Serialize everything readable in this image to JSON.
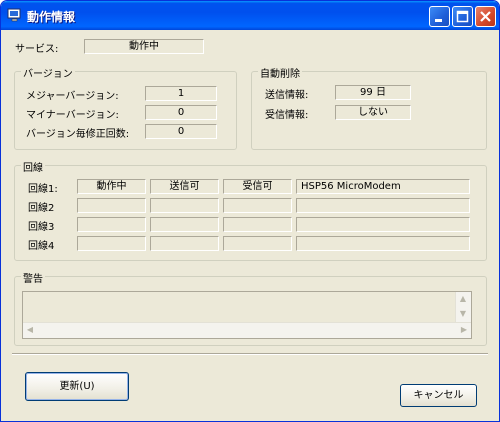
{
  "window": {
    "title": "動作情報"
  },
  "service": {
    "label": "サービス:",
    "value": "動作中"
  },
  "version": {
    "group_title": "バージョン",
    "major_label": "メジャーバージョン:",
    "major_value": "1",
    "minor_label": "マイナーバージョン:",
    "minor_value": "0",
    "patch_label": "バージョン毎修正回数:",
    "patch_value": "0"
  },
  "auto_delete": {
    "group_title": "自動削除",
    "send_label": "送信情報:",
    "send_value": "99 日",
    "recv_label": "受信情報:",
    "recv_value": "しない"
  },
  "lines": {
    "group_title": "回線",
    "rows": [
      {
        "label": "回線1:",
        "status": "動作中",
        "send": "送信可",
        "recv": "受信可",
        "device": "HSP56 MicroModem"
      },
      {
        "label": "回線2",
        "status": "",
        "send": "",
        "recv": "",
        "device": ""
      },
      {
        "label": "回線3",
        "status": "",
        "send": "",
        "recv": "",
        "device": ""
      },
      {
        "label": "回線4",
        "status": "",
        "send": "",
        "recv": "",
        "device": ""
      }
    ]
  },
  "warning": {
    "group_title": "警告",
    "text": ""
  },
  "buttons": {
    "refresh": "更新(U)",
    "cancel": "キャンセル"
  },
  "colors": {
    "titlebar": "#0054e3",
    "face": "#ece9d8"
  }
}
